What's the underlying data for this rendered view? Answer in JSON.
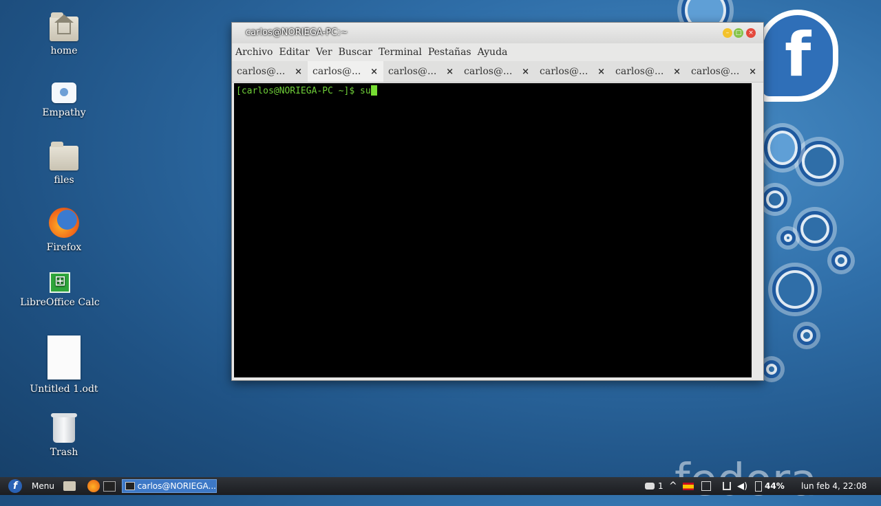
{
  "desktop": {
    "icons": [
      {
        "label": "home",
        "icon": "home-folder-icon"
      },
      {
        "label": "Empathy",
        "icon": "empathy-icon"
      },
      {
        "label": "files",
        "icon": "folder-icon"
      },
      {
        "label": "Firefox",
        "icon": "firefox-icon"
      },
      {
        "label": "LibreOffice Calc",
        "icon": "libreoffice-calc-icon"
      },
      {
        "label": "Untitled 1.odt",
        "icon": "document-icon"
      },
      {
        "label": "Trash",
        "icon": "trash-icon"
      }
    ],
    "watermark": "fedora"
  },
  "window": {
    "title": "carlos@NORIEGA-PC:~",
    "menu": [
      "Archivo",
      "Editar",
      "Ver",
      "Buscar",
      "Terminal",
      "Pestañas",
      "Ayuda"
    ],
    "tabs": [
      {
        "label": "carlos@...",
        "active": false
      },
      {
        "label": "carlos@...",
        "active": true
      },
      {
        "label": "carlos@...",
        "active": false
      },
      {
        "label": "carlos@...",
        "active": false
      },
      {
        "label": "carlos@...",
        "active": false
      },
      {
        "label": "carlos@...",
        "active": false
      },
      {
        "label": "carlos@...",
        "active": false
      }
    ],
    "tab_close_glyph": "×",
    "terminal": {
      "prompt": "[carlos@NORIEGA-PC ~]$ ",
      "input": "su",
      "text_color": "#6fcf38"
    }
  },
  "taskbar": {
    "menu_label": "Menu",
    "task_label": "carlos@NORIEGA...",
    "notification_count": "1",
    "battery": "44%",
    "clock": "lun feb  4, 22:08"
  }
}
